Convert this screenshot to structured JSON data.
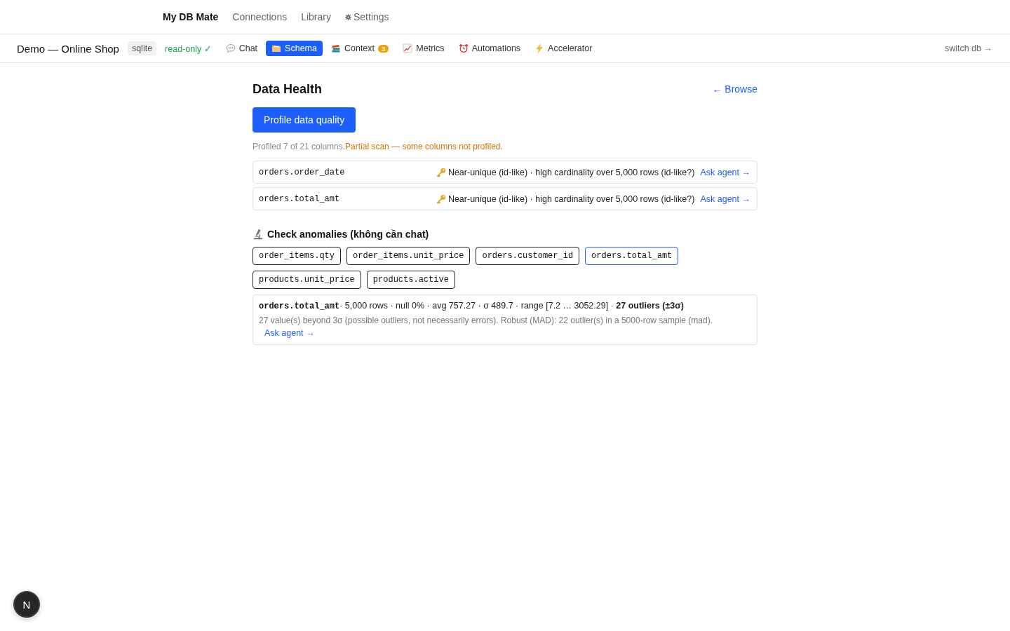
{
  "app_nav": {
    "brand": "My DB Mate",
    "links": [
      {
        "label": "Connections"
      },
      {
        "label": "Library"
      },
      {
        "label": "Settings"
      }
    ]
  },
  "db_bar": {
    "name": "Demo — Online Shop",
    "engine": "sqlite",
    "mode": "read-only ✓",
    "tabs": [
      {
        "label": "Chat",
        "selected": false
      },
      {
        "label": "Schema",
        "selected": true
      },
      {
        "label": "Context",
        "selected": false,
        "badge": "3"
      },
      {
        "label": "Metrics",
        "selected": false
      },
      {
        "label": "Automations",
        "selected": false
      },
      {
        "label": "Accelerator",
        "selected": false
      }
    ],
    "switch_link": "switch db →"
  },
  "page": {
    "title": "Data Health",
    "back_link": "← Browse",
    "profile_button": "Profile data quality",
    "scan_note": {
      "summary": "Profiled 7 of 21 columns.",
      "warning": "Partial scan — some columns not profiled."
    },
    "findings": [
      {
        "column": "orders.order_date",
        "message": "Near-unique (id-like) · high cardinality over 5,000 rows (id-like?)",
        "action": "Ask agent →"
      },
      {
        "column": "orders.total_amt",
        "message": "Near-unique (id-like) · high cardinality over 5,000 rows (id-like?)",
        "action": "Ask agent →"
      }
    ],
    "anomalies": {
      "title": "Check anomalies (không cần chat)",
      "columns": [
        {
          "label": "order_items.qty",
          "selected": false
        },
        {
          "label": "order_items.unit_price",
          "selected": false
        },
        {
          "label": "orders.customer_id",
          "selected": false
        },
        {
          "label": "orders.total_amt",
          "selected": true
        },
        {
          "label": "products.unit_price",
          "selected": false
        },
        {
          "label": "products.active",
          "selected": false
        }
      ],
      "result": {
        "column": "orders.total_amt",
        "summary": "· 5,000 rows · null 0% · avg 757.27 · σ 489.7 · range [7.2 … 3052.29] · **27 outliers (±3σ)**",
        "detail": "27 value(s) beyond 3σ (possible outliers, not necessarily errors). Robust (MAD): 22 outlier(s) in a 5000-row sample (mad).",
        "action": "Ask agent →"
      }
    }
  },
  "dev_badge": {
    "label": "N"
  }
}
